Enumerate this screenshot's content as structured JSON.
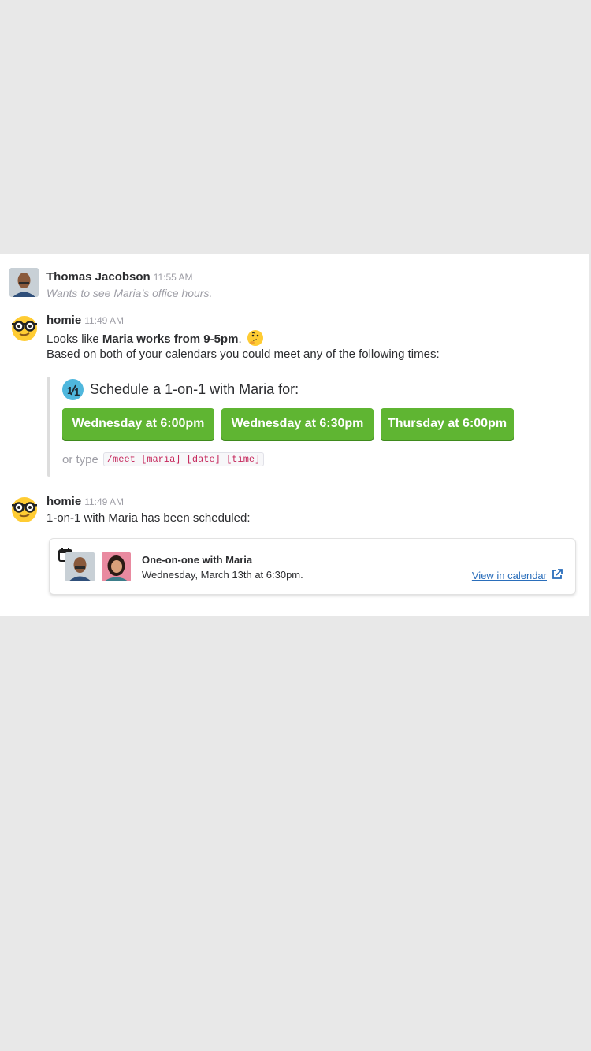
{
  "messages": [
    {
      "author": "Thomas Jacobson",
      "time": "11:55 AM",
      "text": "Wants to see Maria’s office hours."
    },
    {
      "author": "homie",
      "time": "11:49 AM",
      "text_prefix": "Looks like ",
      "text_bold": "Maria works from 9-5pm",
      "text_suffix": ".",
      "emoji": "thinking-face-icon",
      "line2": "Based on both of your calendars you could meet any of the following times:",
      "attachment": {
        "title": "Schedule a 1-on-1 with Maria for:",
        "badge_text": "1/1",
        "buttons": [
          "Wednesday at 6:00pm",
          "Wednesday at 6:30pm",
          "Thursday at 6:00pm"
        ],
        "or_type": "or type",
        "command": "/meet [maria] [date] [time]"
      }
    },
    {
      "author": "homie",
      "time": "11:49 AM",
      "text": "1-on-1 with Maria has been scheduled:",
      "event": {
        "title": "One-on-one with Maria",
        "date": "Wednesday, March 13th at 6:30pm.",
        "link": "View in calendar"
      }
    }
  ],
  "colors": {
    "button_green": "#5fb532",
    "link_blue": "#2a6ebb",
    "badge_blue": "#4fb7dd",
    "code_red": "#c6285c"
  }
}
